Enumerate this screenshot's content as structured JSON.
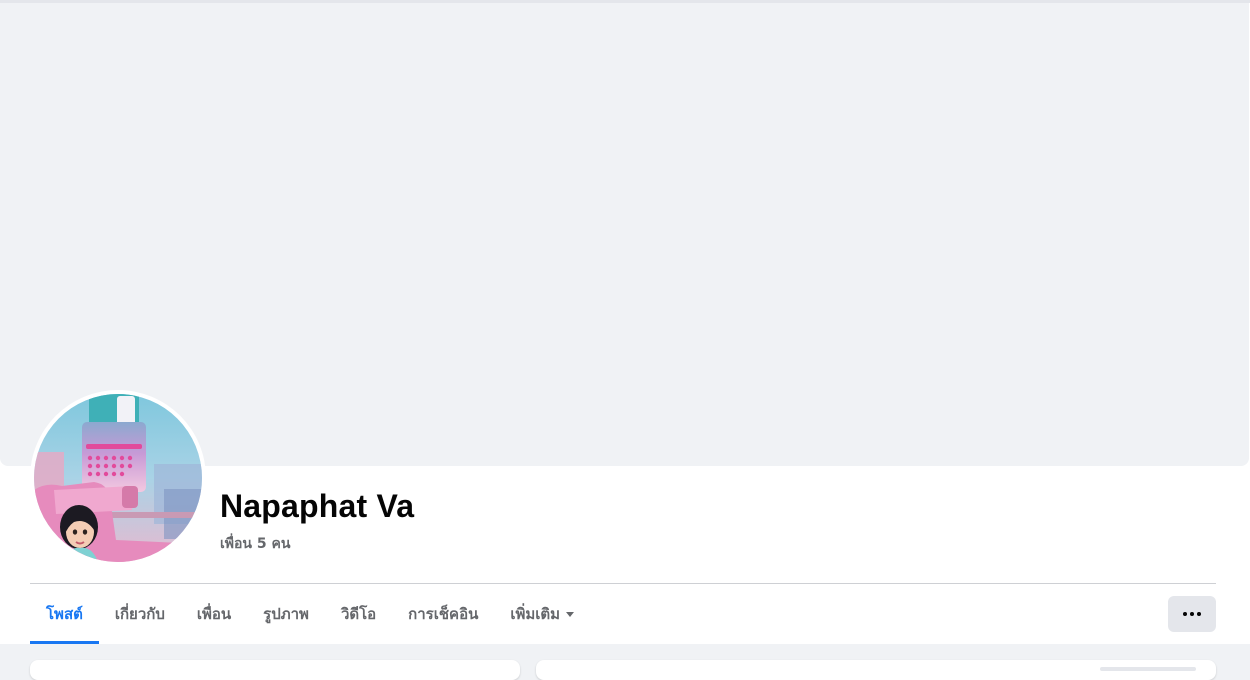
{
  "profile": {
    "name": "Napaphat Va",
    "friends_count": "เพื่อน 5 คน"
  },
  "tabs": [
    {
      "label": "โพสต์",
      "active": true
    },
    {
      "label": "เกี่ยวกับ",
      "active": false
    },
    {
      "label": "เพื่อน",
      "active": false
    },
    {
      "label": "รูปภาพ",
      "active": false
    },
    {
      "label": "วิดีโอ",
      "active": false
    },
    {
      "label": "การเช็คอิน",
      "active": false
    },
    {
      "label": "เพิ่มเติม",
      "active": false,
      "has_dropdown": true
    }
  ],
  "icons": {
    "more_menu": "ellipsis-icon",
    "dropdown": "caret-down-icon"
  },
  "colors": {
    "accent": "#1877f2",
    "text_primary": "#050505",
    "text_secondary": "#65676b",
    "cover_bg": "#f0f2f5",
    "button_bg": "#e4e6eb"
  }
}
